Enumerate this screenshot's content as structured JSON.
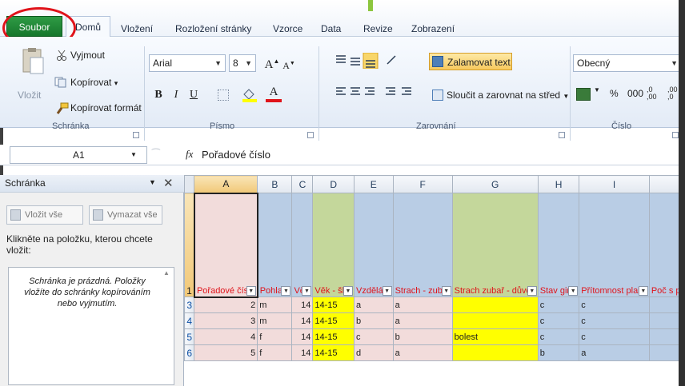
{
  "ribbon_tabs": {
    "file": "Soubor",
    "home": "Domů",
    "insert": "Vložení",
    "page_layout": "Rozložení stránky",
    "formulas": "Vzorce",
    "data": "Data",
    "review": "Revize",
    "view": "Zobrazení"
  },
  "clipboard_group": {
    "paste": "Vložit",
    "cut": "Vyjmout",
    "copy": "Kopírovat",
    "copy_arrow": "▾",
    "format_painter": "Kopírovat formát",
    "label": "Schránka"
  },
  "font_group": {
    "font_name": "Arial",
    "font_size": "8",
    "bold": "B",
    "italic": "I",
    "underline": "U",
    "grow": "A",
    "shrink": "A",
    "font_color_letter": "A",
    "label": "Písmo"
  },
  "alignment_group": {
    "wrap_text": "Zalamovat text",
    "merge_center": "Sloučit a zarovnat na střed",
    "label": "Zarovnání"
  },
  "number_group": {
    "format": "Obecný",
    "percent": "%",
    "thousands": "000",
    "inc_decimal": ",0 ,00",
    "dec_decimal": ",00 ,0",
    "label": "Číslo"
  },
  "formula_bar": {
    "name_box": "A1",
    "fx": "fx",
    "content": "Pořadové číslo"
  },
  "task_pane": {
    "title": "Schránka",
    "paste_all": "Vložit vše",
    "clear_all": "Vymazat vše",
    "instructions": "Klikněte na položku, kterou chcete vložit:",
    "empty_text": "Schránka je prázdná. Položky vložíte do schránky kopírováním nebo vyjmutím."
  },
  "sheet": {
    "columns": [
      "A",
      "B",
      "C",
      "D",
      "E",
      "F",
      "G",
      "H",
      "I",
      ""
    ],
    "header_row_number": "1",
    "headers": [
      "Pořadové číslo",
      "Pohlaví",
      "Věk",
      "Věk - šká",
      "Vzdělání",
      "Strach - zubař",
      "Strach zubař - důvod",
      "Stav ging",
      "Přítomnost plaku",
      "Poč s pl"
    ],
    "rows": [
      {
        "num": "3",
        "cells": [
          "2",
          "m",
          "14",
          "14-15",
          "a",
          "a",
          "",
          "c",
          "c",
          ""
        ]
      },
      {
        "num": "4",
        "cells": [
          "3",
          "m",
          "14",
          "14-15",
          "b",
          "a",
          "",
          "c",
          "c",
          ""
        ]
      },
      {
        "num": "5",
        "cells": [
          "4",
          "f",
          "14",
          "14-15",
          "c",
          "b",
          "bolest",
          "c",
          "c",
          ""
        ]
      },
      {
        "num": "6",
        "cells": [
          "5",
          "f",
          "14",
          "14-15",
          "d",
          "a",
          "",
          "b",
          "a",
          ""
        ]
      }
    ]
  }
}
